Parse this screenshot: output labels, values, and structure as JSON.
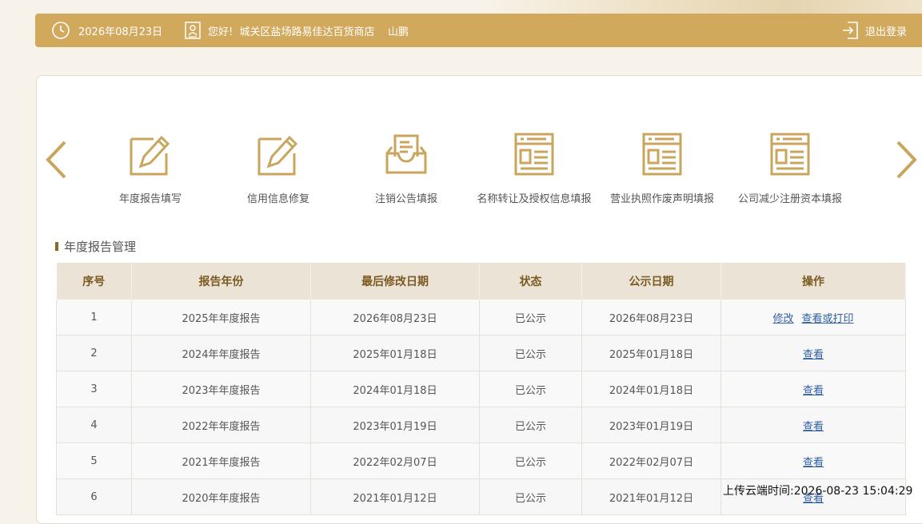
{
  "header": {
    "date": "2026年08月23日",
    "greeting": "您好!  城关区盐场路易佳达百货商店    山鹏",
    "logout_label": "退出登录",
    "clock_icon": "clock-icon",
    "user_icon": "user-card-icon",
    "logout_icon": "logout-icon"
  },
  "nav": {
    "prev_icon": "chevron-left-icon",
    "next_icon": "chevron-right-icon",
    "items": [
      {
        "label": "年度报告填写",
        "icon": "edit-form-icon"
      },
      {
        "label": "信用信息修复",
        "icon": "edit-form-icon"
      },
      {
        "label": "注销公告填报",
        "icon": "inbox-doc-icon"
      },
      {
        "label": "名称转让及授权信息填报",
        "icon": "document-window-icon"
      },
      {
        "label": "营业执照作废声明填报",
        "icon": "document-window-icon"
      },
      {
        "label": "公司减少注册资本填报",
        "icon": "document-window-icon"
      }
    ]
  },
  "section": {
    "title": "年度报告管理"
  },
  "table": {
    "headers": [
      "序号",
      "报告年份",
      "最后修改日期",
      "状态",
      "公示日期",
      "操作"
    ],
    "rows": [
      {
        "no": "1",
        "year": "2025年年度报告",
        "modified": "2026年08月23日",
        "status": "已公示",
        "published": "2026年08月23日",
        "edit": "修改",
        "view": "查看或打印"
      },
      {
        "no": "2",
        "year": "2024年年度报告",
        "modified": "2025年01月18日",
        "status": "已公示",
        "published": "2025年01月18日",
        "view": "查看"
      },
      {
        "no": "3",
        "year": "2023年年度报告",
        "modified": "2024年01月18日",
        "status": "已公示",
        "published": "2024年01月18日",
        "view": "查看"
      },
      {
        "no": "4",
        "year": "2022年年度报告",
        "modified": "2023年01月19日",
        "status": "已公示",
        "published": "2023年01月19日",
        "view": "查看"
      },
      {
        "no": "5",
        "year": "2021年年度报告",
        "modified": "2022年02月07日",
        "status": "已公示",
        "published": "2022年02月07日",
        "view": "查看"
      },
      {
        "no": "6",
        "year": "2020年年度报告",
        "modified": "2021年01月12日",
        "status": "已公示",
        "published": "2021年01月12日",
        "view": "查看"
      }
    ]
  },
  "footer": {
    "upload_time": "上传云端时间:2026-08-23 15:04:29"
  },
  "colors": {
    "accent": "#d1a95c",
    "header_text": "#7a5a22",
    "link": "#2f5fa6"
  }
}
